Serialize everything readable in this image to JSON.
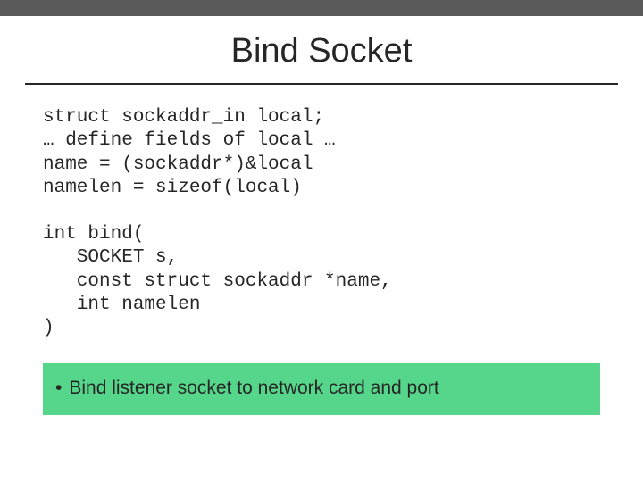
{
  "title": "Bind Socket",
  "code1": "struct sockaddr_in local;\n… define fields of local …\nname = (sockaddr*)&local\nnamelen = sizeof(local)",
  "code2": "int bind(\n   SOCKET s,\n   const struct sockaddr *name,\n   int namelen\n)",
  "bullet": "Bind listener socket to network card and port"
}
